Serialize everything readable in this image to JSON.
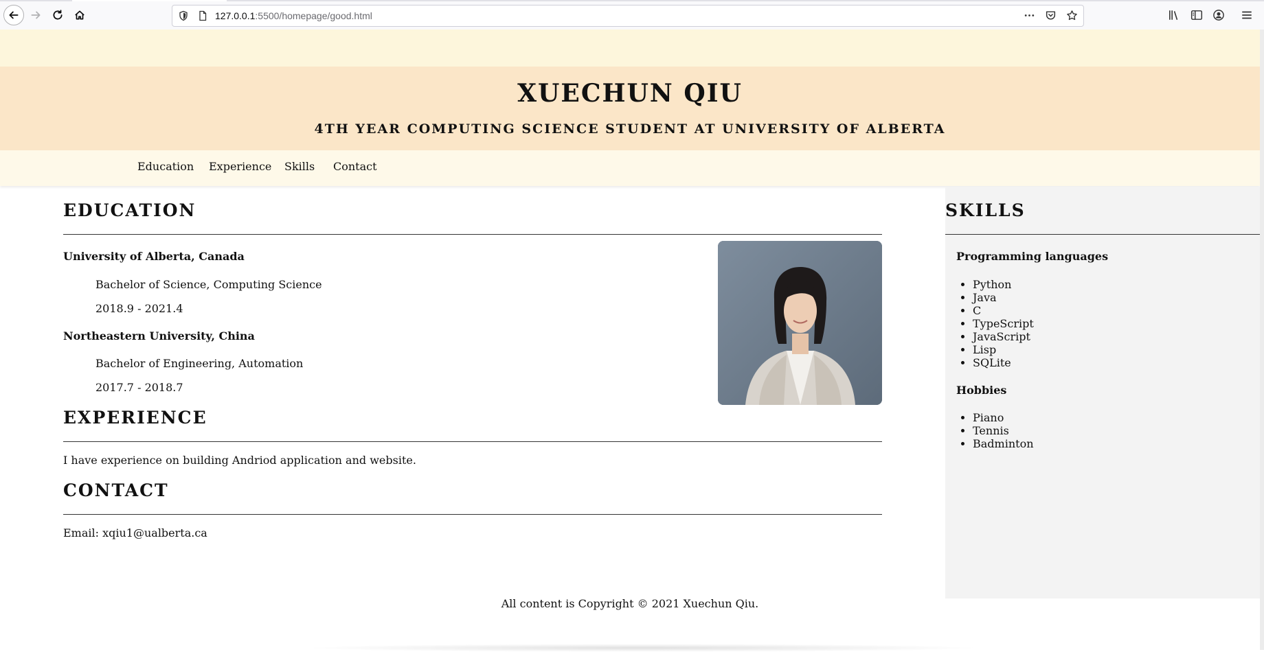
{
  "browser": {
    "url_host": "127.0.0.1",
    "url_rest": ":5500/homepage/good.html"
  },
  "header": {
    "name": "XUECHUN QIU",
    "subtitle": "4TH YEAR COMPUTING SCIENCE STUDENT AT UNIVERSITY OF ALBERTA"
  },
  "nav": {
    "items": [
      {
        "label": "Education"
      },
      {
        "label": "Experience"
      },
      {
        "label": "Skills"
      },
      {
        "label": "Contact"
      }
    ]
  },
  "education": {
    "title": "EDUCATION",
    "schools": [
      {
        "name": "University of Alberta, Canada",
        "degree": "Bachelor of Science, Computing Science",
        "dates": "2018.9 - 2021.4"
      },
      {
        "name": "Northeastern University, China",
        "degree": "Bachelor of Engineering, Automation",
        "dates": "2017.7 - 2018.7"
      }
    ]
  },
  "experience": {
    "title": "EXPERIENCE",
    "text": "I have experience on building Andriod application and website."
  },
  "contact": {
    "title": "CONTACT",
    "text": "Email: xqiu1@ualberta.ca"
  },
  "skills": {
    "title": "SKILLS",
    "programming_heading": "Programming languages",
    "languages": [
      "Python",
      "Java",
      "C",
      "TypeScript",
      "JavaScript",
      "Lisp",
      "SQLite"
    ],
    "hobbies_heading": "Hobbies",
    "hobbies": [
      "Piano",
      "Tennis",
      "Badminton"
    ]
  },
  "footer": {
    "text": "All content is Copyright © 2021 Xuechun Qiu."
  },
  "colors": {
    "top_band": "#fdf6dc",
    "header_bg": "#fbe6c8",
    "nav_bg": "#fef9e9",
    "sidebar_bg": "#f3f3f3"
  }
}
